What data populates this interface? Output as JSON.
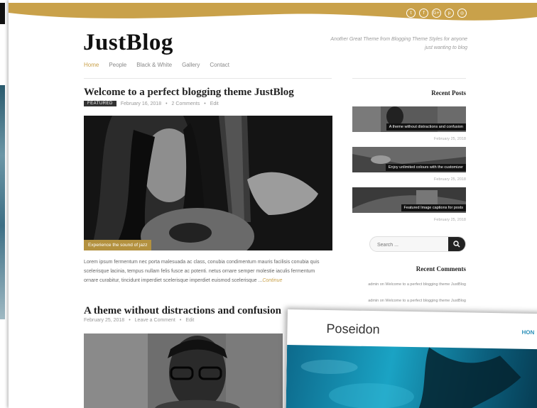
{
  "site": {
    "logo": "JustBlog",
    "tagline": "Another Great Theme from Blogging Theme Styles for anyone just wanting to blog",
    "nav": [
      "Home",
      "People",
      "Black & White",
      "Gallery",
      "Contact"
    ],
    "social_icons": [
      "twitter-icon",
      "facebook-icon",
      "google-plus-icon",
      "pinterest-icon",
      "instagram-icon"
    ],
    "social_glyphs": [
      "t",
      "f",
      "G+",
      "p",
      "◎"
    ],
    "accent_color": "#c9a14a"
  },
  "posts": [
    {
      "title": "Welcome to a perfect blogging theme JustBlog",
      "badge": "FEATURED",
      "date": "February 16, 2018",
      "comments": "2 Comments",
      "edit": "Edit",
      "image_caption": "Experience the sound of jazz",
      "excerpt": "Lorem ipsum fermentum nec porta malesuada ac class, conubia condimentum mauris facilisis conubia quis scelerisque lacinia, tempus nullam felis fusce ac potenti. netus ornare semper molestie iaculis fermentum ornare curabitur, tincidunt imperdiet scelerisque imperdiet euismod scelerisque ...",
      "more": "Continue"
    },
    {
      "title": "A theme without distractions and confusion",
      "date": "February 25, 2018",
      "comments": "Leave a Comment",
      "edit": "Edit"
    }
  ],
  "sidebar": {
    "recent_posts_heading": "Recent Posts",
    "recent_posts": [
      {
        "caption": "A theme without distractions and confusion",
        "date": "February 25, 2018"
      },
      {
        "caption": "Enjoy unlimited colours with the customizer",
        "date": "February 25, 2018"
      },
      {
        "caption": "Featured Image captions for posts",
        "date": "February 25, 2018"
      }
    ],
    "search_placeholder": "Search ...",
    "recent_comments_heading": "Recent Comments",
    "recent_comments": [
      "admin on Welcome to a perfect blogging theme JustBlog",
      "admin on Welcome to a perfect blogging theme JustBlog"
    ]
  },
  "overlay": {
    "title": "Poseidon",
    "nav_partial": "HON"
  }
}
